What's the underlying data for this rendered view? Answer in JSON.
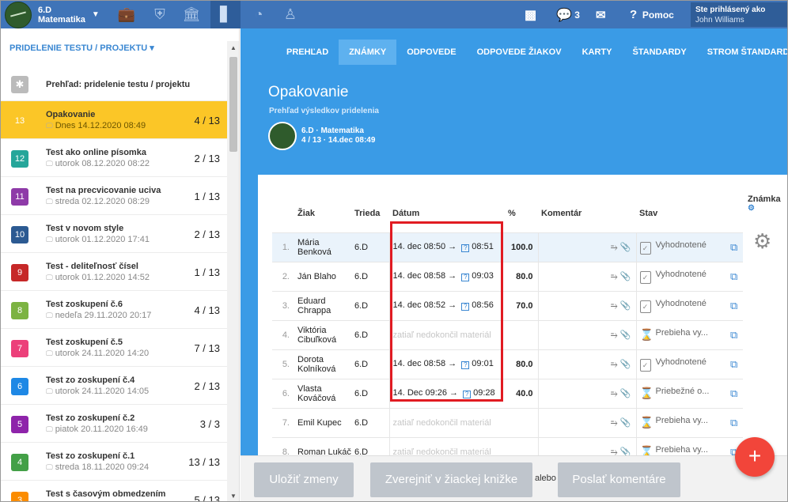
{
  "topbar": {
    "class_name": "6.D",
    "subject": "Matematika",
    "messages_count": "3",
    "help_label": "Pomoc",
    "user_label": "Ste prihlásený ako",
    "user_name": "John Williams"
  },
  "sidebar": {
    "header": "PRIDELENIE TESTU / PROJEKTU ▾",
    "overview": "Prehľad: pridelenie testu / projektu",
    "items": [
      {
        "num": "13",
        "name": "Opakovanie",
        "sub": "Dnes 14.12.2020 08:49",
        "count": "4 / 13",
        "color": "#fbc627",
        "active": true
      },
      {
        "num": "12",
        "name": "Test ako online písomka",
        "sub": "utorok 08.12.2020 08:22",
        "count": "2 / 13",
        "color": "#26a69a"
      },
      {
        "num": "11",
        "name": "Test na precvicovanie uciva",
        "sub": "streda 02.12.2020 08:29",
        "count": "1 / 13",
        "color": "#8e3aa8"
      },
      {
        "num": "10",
        "name": "Test v novom style",
        "sub": "utorok 01.12.2020 17:41",
        "count": "2 / 13",
        "color": "#2c5a92"
      },
      {
        "num": "9",
        "name": "Test - deliteľnosť čísel",
        "sub": "utorok 01.12.2020 14:52",
        "count": "1 / 13",
        "color": "#c62828"
      },
      {
        "num": "8",
        "name": "Test zoskupení č.6",
        "sub": "nedeľa 29.11.2020 20:17",
        "count": "4 / 13",
        "color": "#7cb342"
      },
      {
        "num": "7",
        "name": "Test zoskupení č.5",
        "sub": "utorok 24.11.2020 14:20",
        "count": "7 / 13",
        "color": "#ec407a"
      },
      {
        "num": "6",
        "name": "Test zo zoskupení č.4",
        "sub": "utorok 24.11.2020 14:05",
        "count": "2 / 13",
        "color": "#1e88e5"
      },
      {
        "num": "5",
        "name": "Test zo zoskupení č.2",
        "sub": "piatok 20.11.2020 16:49",
        "count": "3 / 3",
        "color": "#8e24aa"
      },
      {
        "num": "4",
        "name": "Test zo zoskupení č.1",
        "sub": "streda 18.11.2020 09:24",
        "count": "13 / 13",
        "color": "#43a047"
      },
      {
        "num": "3",
        "name": "Test s časovým obmedzením",
        "sub": "streda 21.10.2020 09:08",
        "count": "5 / 13",
        "color": "#fb8c00"
      }
    ]
  },
  "tabs": [
    "PREHĽAD",
    "ZNÁMKY",
    "ODPOVEDE",
    "ODPOVEDE ŽIAKOV",
    "KARTY",
    "ŠTANDARDY",
    "STROM ŠTANDARDOV"
  ],
  "header": {
    "title": "Opakovanie",
    "subtitle": "Prehľad výsledkov pridelenia",
    "class_line": "6.D · Matematika",
    "class_info": "4 / 13 · 14.dec 08:49"
  },
  "table": {
    "columns": [
      "Žiak",
      "Trieda",
      "Dátum",
      "%",
      "Komentár",
      "Stav",
      "Známka"
    ],
    "rows": [
      {
        "i": "1.",
        "name": "Mária Benková",
        "cls": "6.D",
        "start": "14. dec 08:50",
        "end": "08:51",
        "pct": "100.0",
        "status": "Vyhodnotené",
        "icon": "check"
      },
      {
        "i": "2.",
        "name": "Ján Blaho",
        "cls": "6.D",
        "start": "14. dec 08:58",
        "end": "09:03",
        "pct": "80.0",
        "status": "Vyhodnotené",
        "icon": "check"
      },
      {
        "i": "3.",
        "name": "Eduard Chrappa",
        "cls": "6.D",
        "start": "14. dec 08:52",
        "end": "08:56",
        "pct": "70.0",
        "status": "Vyhodnotené",
        "icon": "check"
      },
      {
        "i": "4.",
        "name": "Viktória Cibuľková",
        "cls": "6.D",
        "pending": "zatiaľ nedokončil materiál",
        "status": "Prebieha vy...",
        "icon": "hourglass"
      },
      {
        "i": "5.",
        "name": "Dorota Kolníková",
        "cls": "6.D",
        "start": "14. dec 08:58",
        "end": "09:01",
        "pct": "80.0",
        "status": "Vyhodnotené",
        "icon": "check"
      },
      {
        "i": "6.",
        "name": "Vlasta Kováčová",
        "cls": "6.D",
        "start": "14. Dec 09:26",
        "end": "09:28",
        "pct": "40.0",
        "status": "Priebežné o...",
        "icon": "hourglass"
      },
      {
        "i": "7.",
        "name": "Emil Kupec",
        "cls": "6.D",
        "pending": "zatiaľ nedokončil materiál",
        "status": "Prebieha vy...",
        "icon": "hourglass"
      },
      {
        "i": "8.",
        "name": "Roman Lukáč",
        "cls": "6.D",
        "pending": "zatiaľ nedokončil materiál",
        "status": "Prebieha vy...",
        "icon": "hourglass"
      }
    ]
  },
  "buttons": {
    "save": "Uložiť zmeny",
    "publish": "Zverejniť v žiackej knižke",
    "or": "alebo",
    "send": "Poslať komentáre"
  },
  "fab": "+"
}
